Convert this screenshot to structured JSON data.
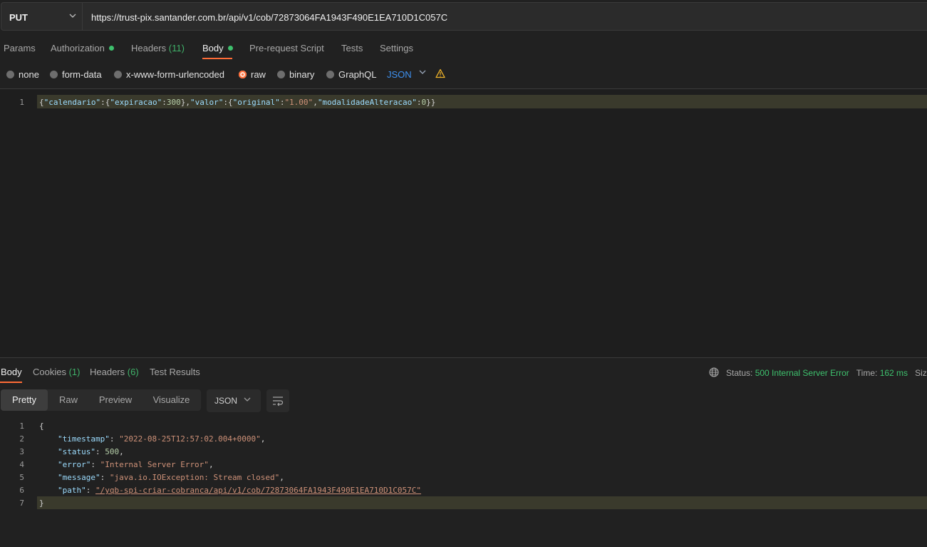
{
  "request": {
    "method": "PUT",
    "url": "https://trust-pix.santander.com.br/api/v1/cob/72873064FA1943F490E1EA710D1C057C",
    "tabs": {
      "params": "Params",
      "authorization": "Authorization",
      "headers": "Headers",
      "headers_count": "(11)",
      "body": "Body",
      "prerequest": "Pre-request Script",
      "tests": "Tests",
      "settings": "Settings"
    },
    "body_modes": {
      "none": "none",
      "form_data": "form-data",
      "urlencoded": "x-www-form-urlencoded",
      "raw": "raw",
      "binary": "binary",
      "graphql": "GraphQL",
      "selected": "raw"
    },
    "raw_format": "JSON",
    "body_line_number": "1",
    "body_code": {
      "p1": "{",
      "k1": "\"calendario\"",
      "p2": ":{",
      "k2": "\"expiracao\"",
      "p3": ":",
      "n1": "300",
      "p4": "},",
      "k3": "\"valor\"",
      "p5": ":{",
      "k4": "\"original\"",
      "p6": ":",
      "s1": "\"1.00\"",
      "p7": ",",
      "k5": "\"modalidadeAlteracao\"",
      "p8": ":",
      "n2": "0",
      "p9": "}}"
    }
  },
  "response": {
    "tabs": {
      "body": "Body",
      "cookies": "Cookies",
      "cookies_count": "(1)",
      "headers": "Headers",
      "headers_count": "(6)",
      "test_results": "Test Results"
    },
    "status_label": "Status:",
    "status_value": "500 Internal Server Error",
    "time_label": "Time:",
    "time_value": "162 ms",
    "size_label": "Siz",
    "views": {
      "pretty": "Pretty",
      "raw": "Raw",
      "preview": "Preview",
      "visualize": "Visualize",
      "active": "Pretty"
    },
    "format": "JSON",
    "line_numbers": [
      "1",
      "2",
      "3",
      "4",
      "5",
      "6",
      "7"
    ],
    "json": {
      "open": "{",
      "timestamp_key": "\"timestamp\"",
      "timestamp_val": "\"2022-08-25T12:57:02.004+0000\"",
      "status_key": "\"status\"",
      "status_val": "500",
      "error_key": "\"error\"",
      "error_val": "\"Internal Server Error\"",
      "message_key": "\"message\"",
      "message_val": "\"java.io.IOException: Stream closed\"",
      "path_key": "\"path\"",
      "path_val": "\"/yqb-spi-criar-cobranca/api/v1/cob/72873064FA1943F490E1EA710D1C057C\"",
      "close": "}",
      "colon": ": ",
      "comma": ","
    }
  },
  "colors": {
    "accent": "#ff6c37",
    "success": "#3ec06d",
    "link": "#3e91f0",
    "warning": "#f0b429"
  },
  "icons": {
    "method_dropdown": "chevron-down-icon",
    "format_dropdown": "chevron-down-icon",
    "warning": "warning-icon",
    "globe": "globe-icon",
    "wrap": "wrap-lines-icon"
  }
}
